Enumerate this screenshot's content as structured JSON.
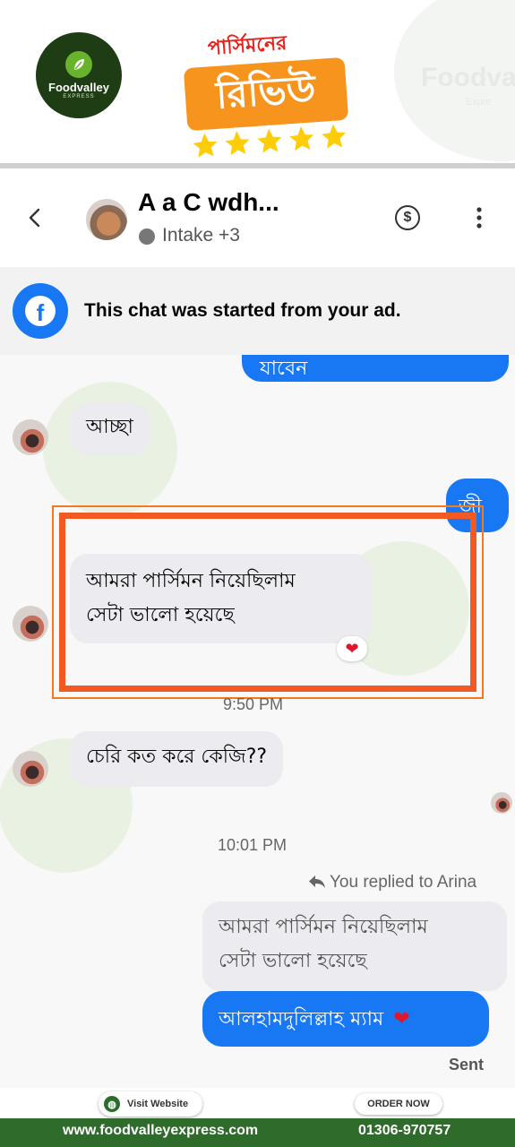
{
  "banner": {
    "logo_name": "Foodvalley",
    "logo_sub": "EXPRESS",
    "watermark_name": "Foodva",
    "watermark_sub": "Expre",
    "review_title": "পার্সিমনের",
    "review_main": "রিভিউ",
    "rating_stars": 5,
    "accent_color": "#f7941d"
  },
  "header": {
    "contact_name": "A   a C    wdh...",
    "contact_sub": "Intake +3",
    "back_icon": "chevron-left-icon",
    "dollar_icon": "dollar-icon",
    "more_icon": "more-vertical-icon"
  },
  "ad_notice": {
    "text": "This chat was started from your ad.",
    "icon": "facebook-icon"
  },
  "messages": {
    "out_1": "যাবেন",
    "in_1": "আচ্ছা",
    "out_2": "জী",
    "in_2_line1": "আমরা পার্সিমন নিয়েছিলাম",
    "in_2_line2": "সেটা ভালো হয়েছে",
    "time_1": "9:50 PM",
    "in_3": "চেরি কত করে কেজি??",
    "time_2": "10:01 PM",
    "reply_note": "You replied to Arina",
    "quoted_line1": "আমরা পার্সিমন নিয়েছিলাম",
    "quoted_line2": "সেটা ভালো হয়েছে",
    "out_3": "আলহামদুলিল্লাহ ম্যাম",
    "out_3_emoji": "❤",
    "reaction": "❤",
    "sent_label": "Sent"
  },
  "footer": {
    "visit_label": "Visit Website",
    "order_label": "ORDER NOW",
    "website": "www.foodvalleyexpress.com",
    "phone": "01306-970757",
    "bar_color": "#2f6b2b"
  }
}
